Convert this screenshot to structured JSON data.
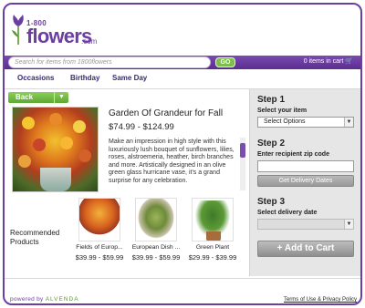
{
  "logo": {
    "small": "1-800",
    "big": "flowers",
    "dotcom": ".com"
  },
  "search": {
    "placeholder": "Search for items from 1800flowers",
    "go_label": "GO"
  },
  "cart": {
    "label": "0 items in cart"
  },
  "nav": {
    "items": [
      "Occasions",
      "Birthday",
      "Same Day"
    ]
  },
  "back": {
    "label": "Back"
  },
  "product": {
    "title": "Garden Of Grandeur for Fall",
    "price": "$74.99 - $124.99",
    "description": "Make an impression in high style with this luxuriously lush bouquet of sunflowers, lilies, roses, alstroemeria, heather, birch branches and more. Artistically designed in an olive green glass hurricane vase, it's a grand surprise for any celebration."
  },
  "steps": {
    "step1": {
      "heading": "Step 1",
      "sub": "Select your item",
      "select_value": "Select Options"
    },
    "step2": {
      "heading": "Step 2",
      "sub": "Enter recipient zip code",
      "button": "Get Delivery Dates"
    },
    "step3": {
      "heading": "Step 3",
      "sub": "Select delivery date",
      "select_value": ""
    },
    "add_to_cart": "+ Add to Cart"
  },
  "recommended": {
    "label": "Recommended Products",
    "items": [
      {
        "name": "Fields of Europ...",
        "price": "$39.99 - $59.99"
      },
      {
        "name": "European Dish ...",
        "price": "$39.99 - $59.99"
      },
      {
        "name": "Green Plant",
        "price": "$29.99 - $39.99"
      }
    ]
  },
  "footer": {
    "powered_prefix": "powered by",
    "powered_brand": "ALVENDA",
    "terms": "Terms of Use & Privacy Policy"
  },
  "colors": {
    "brand_purple": "#6b3fa0",
    "go_green": "#7cc04a",
    "back_green": "#6bb83e"
  }
}
